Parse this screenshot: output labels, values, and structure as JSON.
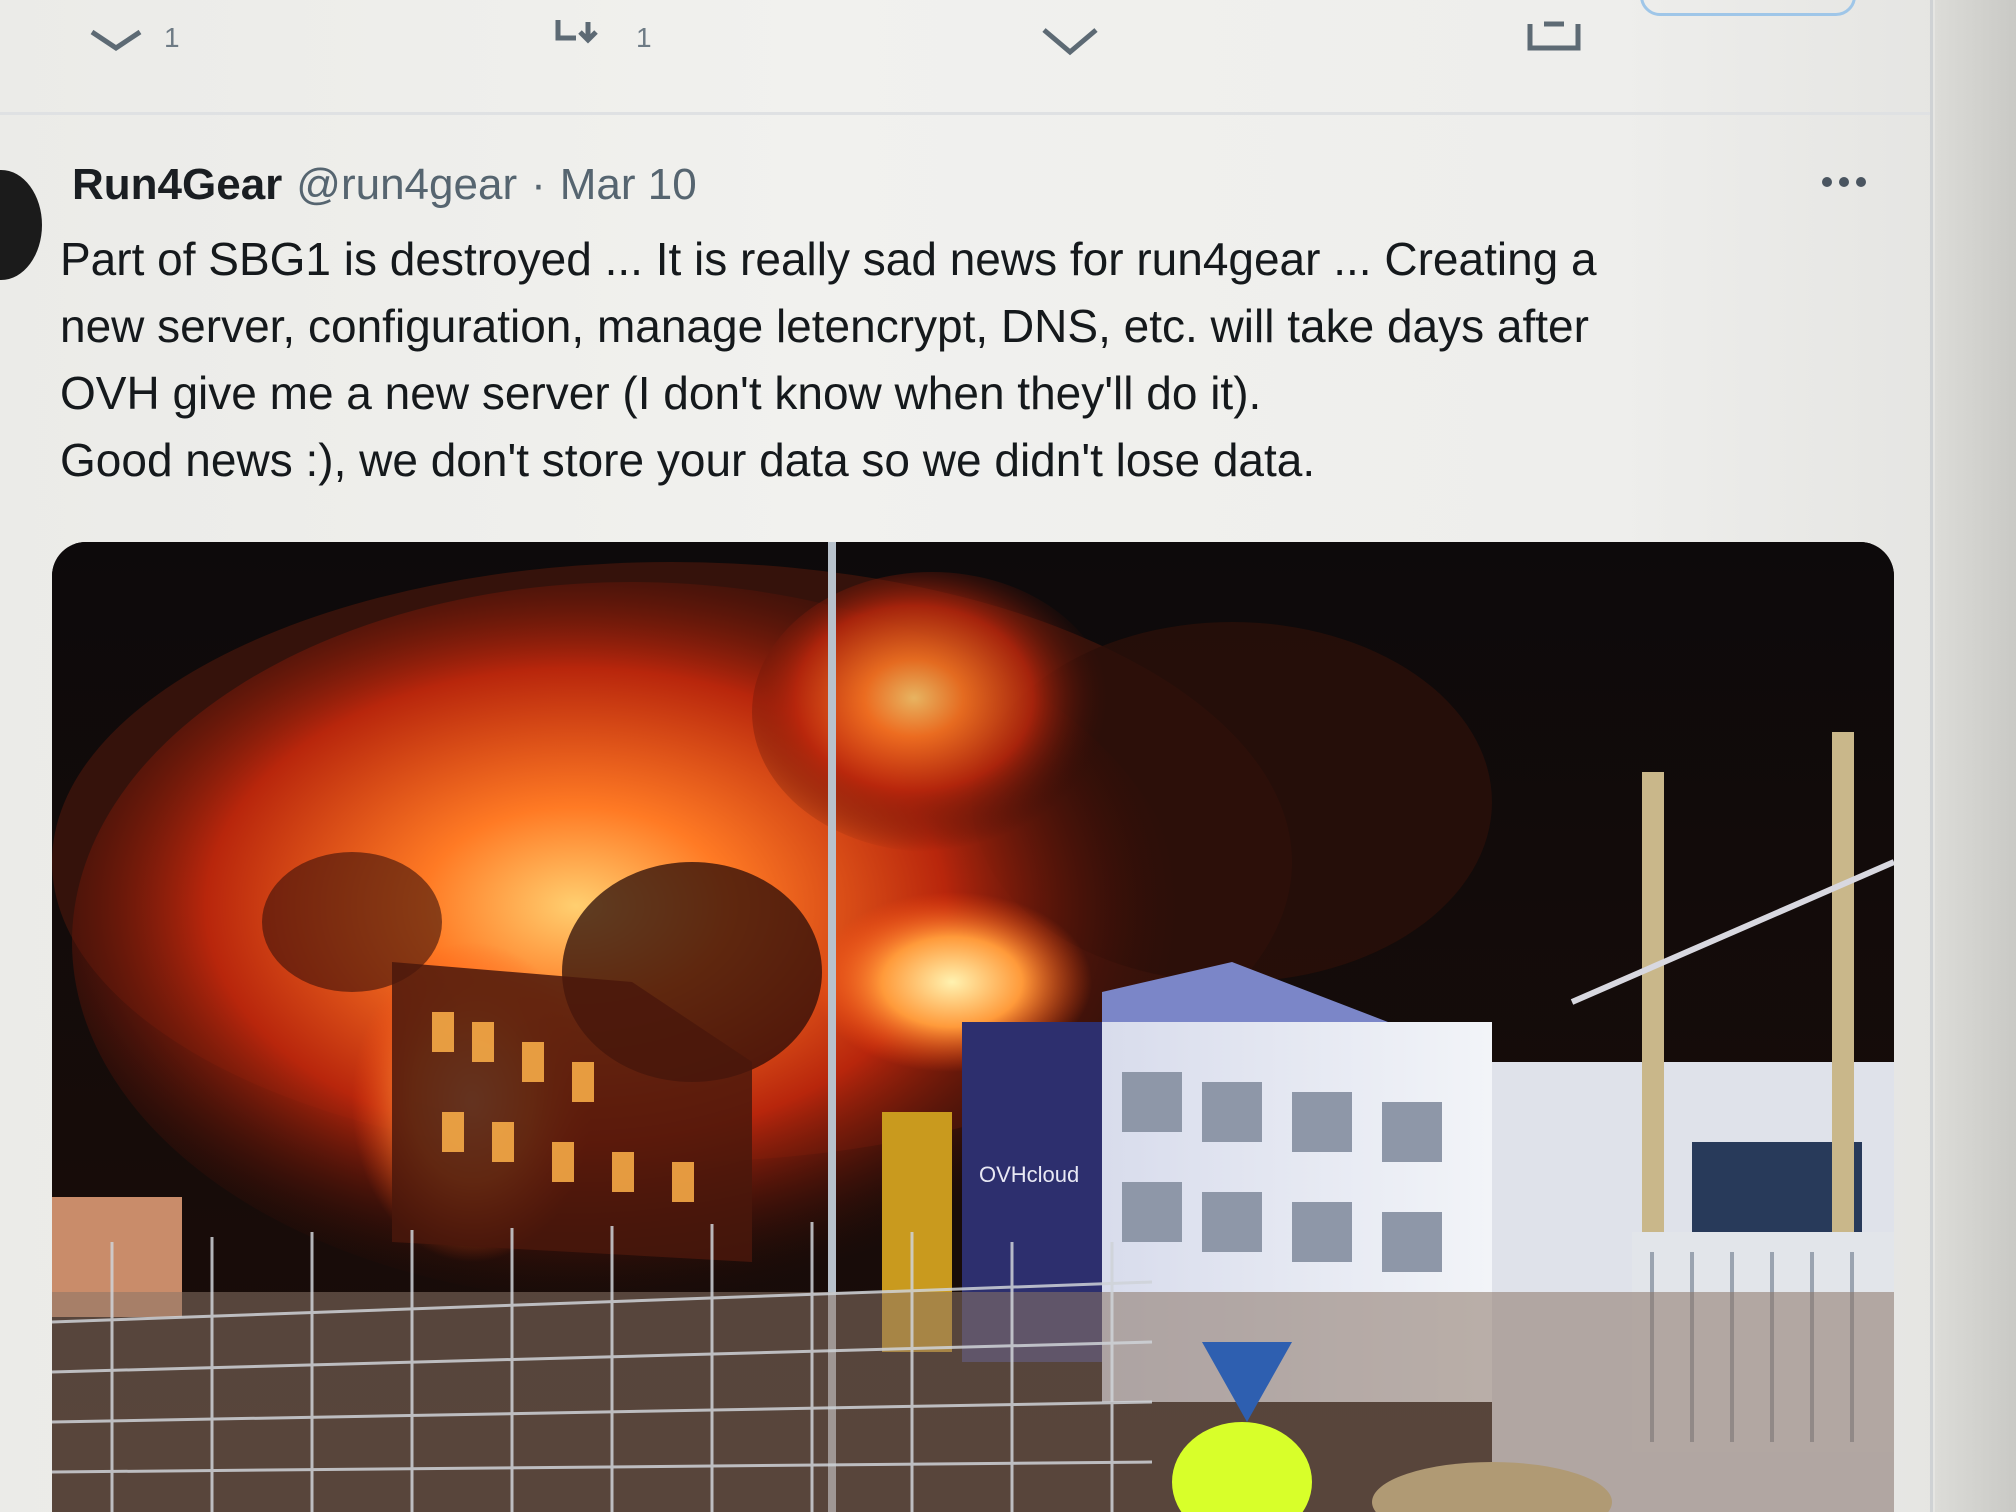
{
  "previous_tweet": {
    "actions": [
      {
        "icon": "reply-icon",
        "count": "1"
      },
      {
        "icon": "retweet-icon",
        "count": "1"
      },
      {
        "icon": "like-icon",
        "count": ""
      },
      {
        "icon": "share-icon",
        "count": ""
      }
    ]
  },
  "tweet": {
    "display_name": "Run4Gear",
    "handle": "@run4gear",
    "separator": "·",
    "date": "Mar 10",
    "more_icon": "more-options-icon",
    "text_lines": [
      "Part of SBG1 is destroyed ... It is really sad news for run4gear ... Creating a",
      "new server, configuration, manage letencrypt, DNS, etc. will take days after",
      "OVH give me a new server (I don't know when they'll do it).",
      "Good news :), we don't store your data so we didn't lose data."
    ],
    "media": {
      "sign_text": "OVHcloud",
      "colors": {
        "fire": "#ff5a1a",
        "fire_core": "#ffb347",
        "smoke": "#3a130b",
        "sky": "#0b0a0c",
        "building_blue": "#2d2f6e",
        "wall_white": "#e6eaf2"
      }
    }
  }
}
